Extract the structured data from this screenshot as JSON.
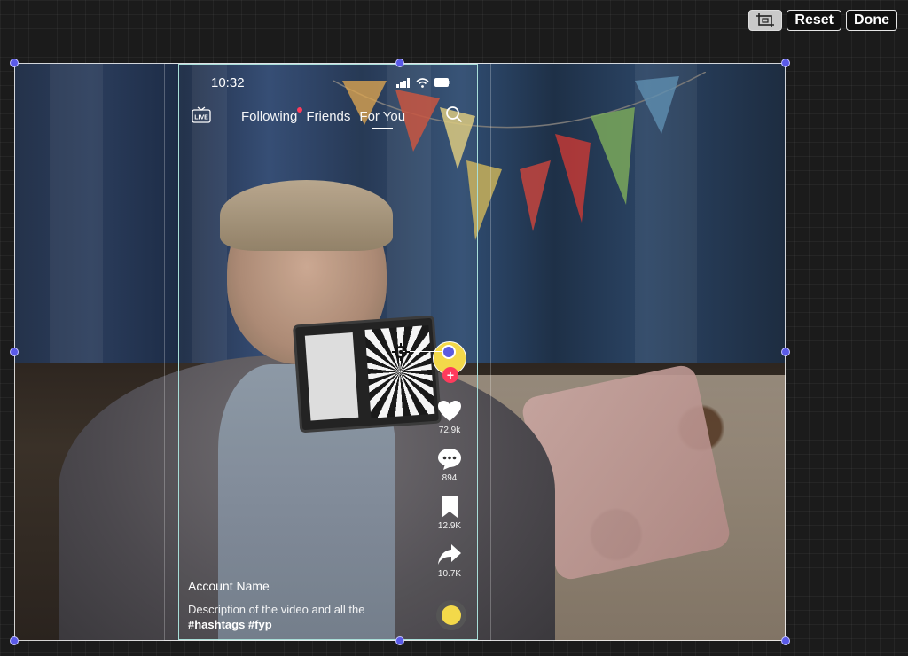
{
  "toolbar": {
    "crop_icon": "crop-icon",
    "reset_label": "Reset",
    "done_label": "Done"
  },
  "phone": {
    "status_time": "10:32",
    "live_label": "LIVE",
    "tabs": [
      {
        "label": "Following",
        "has_dot": true
      },
      {
        "label": "Friends",
        "has_dot": false
      },
      {
        "label": "For You",
        "active": true
      }
    ],
    "counts": {
      "likes": "72.9k",
      "comments": "894",
      "bookmarks": "12.9K",
      "shares": "10.7K"
    },
    "account_name": "Account Name",
    "description": "Description of the video and all the",
    "hashtags": "#hashtags #fyp"
  },
  "colors": {
    "accent": "#5a5ae8",
    "red": "#ff3b5c",
    "yellow": "#f3d94a",
    "phone_border": "#a8ded8"
  }
}
